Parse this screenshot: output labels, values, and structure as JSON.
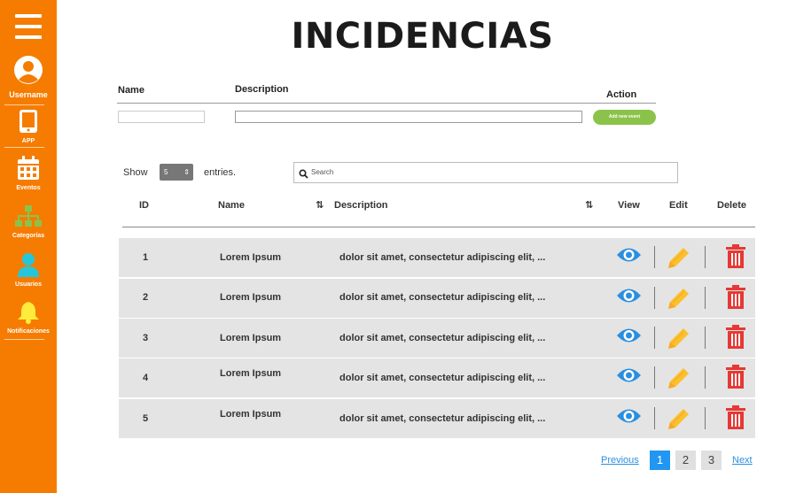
{
  "sidebar": {
    "menu_icon": "hamburger-icon",
    "user": {
      "label": "Username",
      "icon": "user-circle-icon"
    },
    "items": [
      {
        "label": "APP",
        "icon": "tablet-icon",
        "color": "#ffffff"
      },
      {
        "label": "Eventos",
        "icon": "calendar-icon",
        "color": "#ffffff"
      },
      {
        "label": "Categorías",
        "icon": "sitemap-icon",
        "color": "#8bc34a"
      },
      {
        "label": "Usuarios",
        "icon": "user-icon",
        "color": "#26c6da"
      },
      {
        "label": "Notificaciones",
        "icon": "bell-icon",
        "color": "#ffeb3b"
      }
    ],
    "background": "#f57c00"
  },
  "title": "INCIDENCIAS",
  "form": {
    "name_label": "Name",
    "description_label": "Description",
    "action_label": "Action",
    "name_value": "",
    "description_value": "",
    "add_button": "Add new event"
  },
  "table_controls": {
    "show_label": "Show",
    "entries_value": "5",
    "entries_label": "entries.",
    "search_placeholder": "Search"
  },
  "table": {
    "headers": {
      "id": "ID",
      "name": "Name",
      "description": "Description",
      "view": "View",
      "edit": "Edit",
      "delete": "Delete"
    },
    "rows": [
      {
        "id": "1",
        "name": "Lorem Ipsum",
        "description": "dolor sit amet, consectetur adipiscing elit, ..."
      },
      {
        "id": "2",
        "name": "Lorem Ipsum",
        "description": "dolor sit amet, consectetur adipiscing elit, ..."
      },
      {
        "id": "3",
        "name": "Lorem Ipsum",
        "description": "dolor sit amet, consectetur adipiscing elit, ..."
      },
      {
        "id": "4",
        "name": "Lorem Ipsum",
        "description": "dolor sit amet, consectetur adipiscing elit, ..."
      },
      {
        "id": "5",
        "name": "Lorem Ipsum",
        "description": "dolor sit amet, consectetur adipiscing elit, ..."
      }
    ],
    "icons": {
      "view": "eye-icon",
      "edit": "pencil-icon",
      "delete": "trash-icon"
    },
    "colors": {
      "view": "#2a8fe0",
      "edit": "#fbc02d",
      "delete": "#e53935",
      "row_bg": "#e4e4e4"
    }
  },
  "pagination": {
    "previous": "Previous",
    "pages": [
      "1",
      "2",
      "3"
    ],
    "current": "1",
    "next": "Next"
  }
}
